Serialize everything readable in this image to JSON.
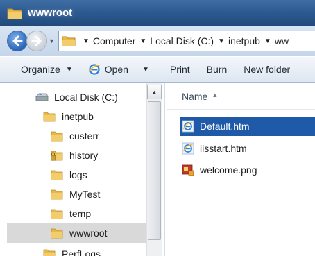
{
  "window": {
    "title": "wwwroot",
    "title_icon": "folder-icon"
  },
  "address_bar": {
    "breadcrumbs": [
      "Computer",
      "Local Disk (C:)",
      "inetpub",
      "ww"
    ]
  },
  "toolbar": {
    "organize_label": "Organize",
    "open_label": "Open",
    "print_label": "Print",
    "burn_label": "Burn",
    "new_folder_label": "New folder"
  },
  "nav_tree": {
    "drive_label": "Local Disk (C:)",
    "items": [
      {
        "label": "inetpub",
        "icon": "folder-icon"
      },
      {
        "label": "custerr",
        "icon": "folder-icon"
      },
      {
        "label": "history",
        "icon": "locked-folder-icon"
      },
      {
        "label": "logs",
        "icon": "folder-icon"
      },
      {
        "label": "MyTest",
        "icon": "folder-icon"
      },
      {
        "label": "temp",
        "icon": "folder-icon"
      },
      {
        "label": "wwwroot",
        "icon": "folder-icon",
        "selected": true
      },
      {
        "label": "PerfLogs",
        "icon": "folder-icon"
      }
    ]
  },
  "file_list": {
    "column_header": "Name",
    "sort_direction": "ascending",
    "files": [
      {
        "name": "Default.htm",
        "icon": "html-file-icon",
        "selected": true
      },
      {
        "name": "iisstart.htm",
        "icon": "html-file-icon"
      },
      {
        "name": "welcome.png",
        "icon": "image-file-icon"
      }
    ]
  },
  "colors": {
    "titlebar": "#2d5b92",
    "selection": "#1e5aa8",
    "folder": "#e8b547",
    "tree_selection": "#d9d9d9"
  }
}
